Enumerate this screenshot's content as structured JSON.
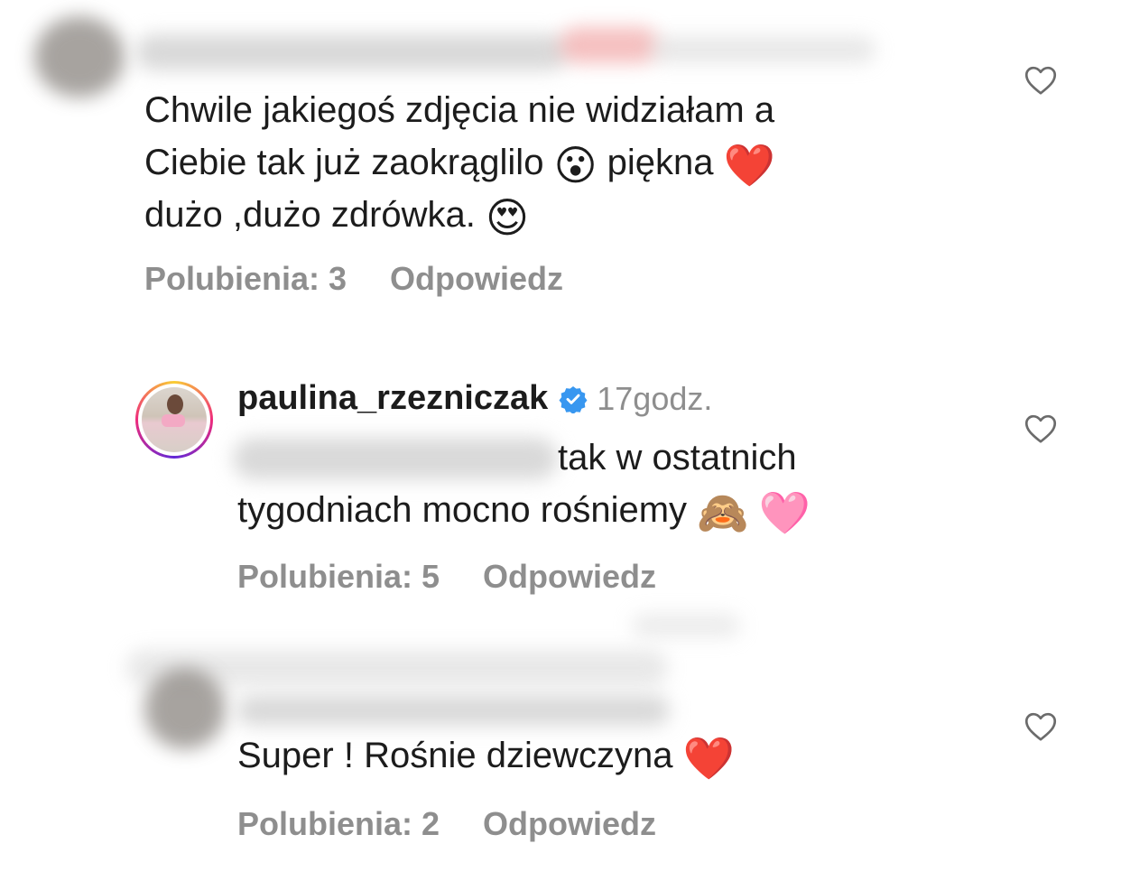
{
  "comments": [
    {
      "text_lines": [
        "Chwile jakiegoś zdjęcia nie widziałam a",
        "Ciebie tak już zaokrąglilo",
        "dużo ,dużo zdrówka."
      ],
      "emojis": [
        "😮",
        "❤️",
        "😍"
      ],
      "emoji_text": [
        "piękna"
      ],
      "likes": "Polubienia: 3",
      "reply": "Odpowiedz"
    },
    {
      "username": "paulina_rzezniczak",
      "time": "17godz.",
      "text_lines": [
        "tak w ostatnich",
        "tygodniach mocno rośniemy"
      ],
      "emojis": [
        "🙈",
        "🩷"
      ],
      "likes": "Polubienia: 5",
      "reply": "Odpowiedz"
    },
    {
      "text_lines": [
        "Super ! Rośnie dziewczyna"
      ],
      "emojis": [
        "❤️"
      ],
      "likes": "Polubienia: 2",
      "reply": "Odpowiedz"
    }
  ],
  "icons": {
    "like": "heart-outline-icon",
    "verified": "verified-badge-icon"
  },
  "colors": {
    "meta_gray": "#8e8e8e",
    "verified_blue": "#3897f0"
  }
}
